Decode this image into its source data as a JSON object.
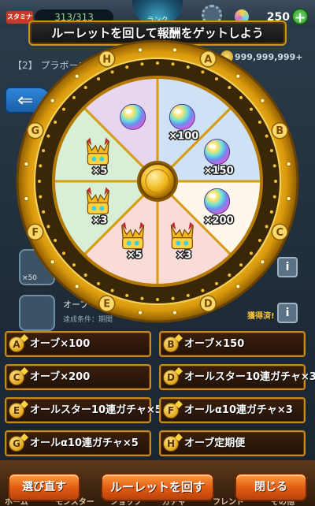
{
  "header": {
    "stamina_label": "スタミナ",
    "stamina_value": "313/313",
    "rank_label": "ランク",
    "orb_count": "250",
    "add_button_label": "+"
  },
  "background": {
    "stage_text": "【2】 プラボー成功",
    "coin_amount": "999,999,999+",
    "side_card_count": "×50",
    "side_text": "オーブ",
    "side_condition": "達成条件：期間",
    "status_text": "獲得済!"
  },
  "title": "ルーレットを回して報酬をゲットしよう",
  "wheel": {
    "segment_letters": [
      "A",
      "B",
      "C",
      "D",
      "E",
      "F",
      "G",
      "H"
    ],
    "segment_colors": [
      "#cfe2f5",
      "#cfe2f5",
      "#fdf7ec",
      "#f9dcd8",
      "#f9dcd8",
      "#d7efd4",
      "#d7efd4",
      "#e6d7ef"
    ],
    "rim_color": "#e6a915",
    "prizes": [
      {
        "segment": "A",
        "icon": "orb-icon",
        "label": "×100"
      },
      {
        "segment": "B",
        "icon": "orb-icon",
        "label": "×150"
      },
      {
        "segment": "C",
        "icon": "orb-icon",
        "label": "×200"
      },
      {
        "segment": "D",
        "icon": "gacha-helmet-icon",
        "label": "×3"
      },
      {
        "segment": "E",
        "icon": "gacha-helmet-icon",
        "label": "×5"
      },
      {
        "segment": "F",
        "icon": "gacha-helmet-icon",
        "label": "×3"
      },
      {
        "segment": "G",
        "icon": "gacha-helmet-icon",
        "label": "×5"
      },
      {
        "segment": "H",
        "icon": "orb-icon",
        "label": ""
      }
    ]
  },
  "prize_list": [
    {
      "letter": "A",
      "label": "オーブ×100"
    },
    {
      "letter": "B",
      "label": "オーブ×150"
    },
    {
      "letter": "C",
      "label": "オーブ×200"
    },
    {
      "letter": "D",
      "label": "オールスター10連ガチャ×3"
    },
    {
      "letter": "E",
      "label": "オールスター10連ガチャ×5"
    },
    {
      "letter": "F",
      "label": "オールα10連ガチャ×3"
    },
    {
      "letter": "G",
      "label": "オールα10連ガチャ×5"
    },
    {
      "letter": "H",
      "label": "オーブ定期便"
    }
  ],
  "actions": {
    "reselect_label": "選び直す",
    "spin_label": "ルーレットを回す",
    "close_label": "閉じる"
  },
  "bottom_nav": [
    "ホーム",
    "モンスター",
    "ショップ",
    "ガチャ",
    "フレンド",
    "その他"
  ]
}
